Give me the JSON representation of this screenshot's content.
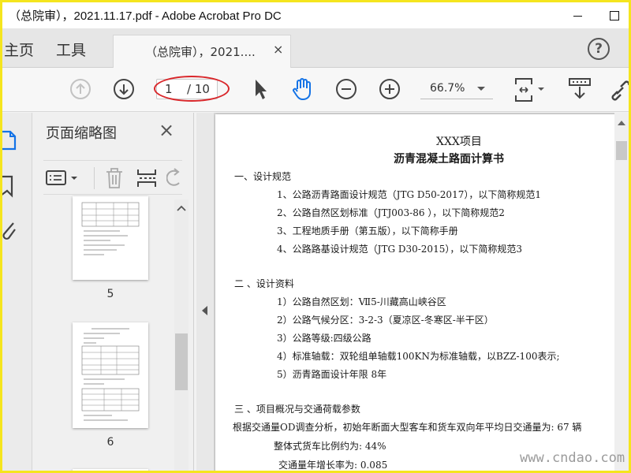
{
  "window": {
    "title": "（总院审），2021.11.17.pdf - Adobe Acrobat Pro DC"
  },
  "menubar": {
    "home_label": "主页",
    "tools_label": "工具",
    "tab_label": "（总院审），2021....",
    "tab_close": "×",
    "help": "?"
  },
  "toolbar": {
    "current_page": "1",
    "total_pages": "/ 10",
    "zoom": "66.7%"
  },
  "thumbnails": {
    "title": "页面缩略图",
    "close": "×",
    "pages": [
      {
        "number": "5"
      },
      {
        "number": "6"
      }
    ]
  },
  "document": {
    "lines": [
      {
        "text": "XXX项目",
        "cls": "h1"
      },
      {
        "text": "沥青混凝土路面计算书",
        "cls": "h2"
      },
      {
        "text": "一、设计规范",
        "cls": ""
      },
      {
        "text": "1、公路沥青路面设计规范（JTG D50-2017），以下简称规范1",
        "cls": ""
      },
      {
        "text": "2、公路自然区划标准（JTJ003-86 ），以下简称规范2",
        "cls": ""
      },
      {
        "text": "3、工程地质手册（第五版），以下简称手册",
        "cls": ""
      },
      {
        "text": "4、公路路基设计规范（JTG D30-2015），以下简称规范3",
        "cls": ""
      },
      {
        "text": "二 、设计资料",
        "cls": ""
      },
      {
        "text": "1）公路自然区划：Ⅶ5-川藏高山峡谷区",
        "cls": ""
      },
      {
        "text": "2）公路气候分区：3-2-3（夏凉区-冬寒区-半干区）",
        "cls": ""
      },
      {
        "text": "3）公路等级:四级公路",
        "cls": ""
      },
      {
        "text": "4）标准轴载：双轮组单轴载100KN为标准轴载，以BZZ-100表示;",
        "cls": ""
      },
      {
        "text": "5）沥青路面设计年限  8年",
        "cls": ""
      },
      {
        "text": "三 、项目概况与交通荷载参数",
        "cls": ""
      },
      {
        "text": "根据交通量OD调查分析，初始年断面大型客车和货车双向年平均日交通量为:  67   辆",
        "cls": ""
      },
      {
        "text": "整体式货车比例约为:   44%",
        "cls": ""
      },
      {
        "text": "交通量年增长率为:   0.085",
        "cls": ""
      }
    ]
  },
  "watermark": "www.cndao.com",
  "colors": {
    "frame_border": "#f5e51e",
    "annotation_oval": "#d9262a",
    "hand_tool": "#1473e6"
  }
}
